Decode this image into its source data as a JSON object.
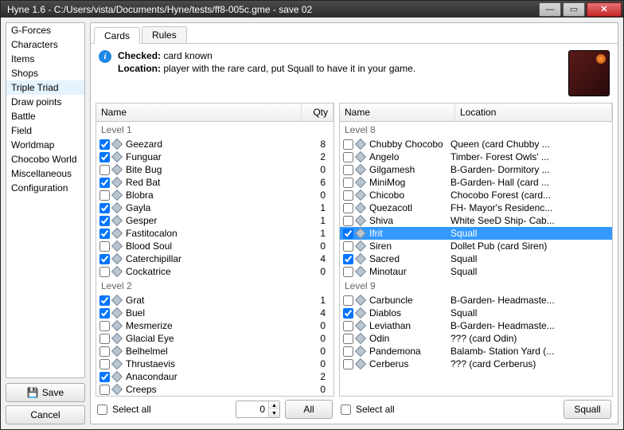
{
  "window": {
    "title": "Hyne 1.6 - C:/Users/vista/Documents/Hyne/tests/ff8-005c.gme - save 02"
  },
  "sidebar": {
    "items": [
      "G-Forces",
      "Characters",
      "Items",
      "Shops",
      "Triple Triad",
      "Draw points",
      "Battle",
      "Field",
      "Worldmap",
      "Chocobo World",
      "Miscellaneous",
      "Configuration"
    ],
    "selected_index": 4,
    "save_label": "Save",
    "cancel_label": "Cancel"
  },
  "tabs": {
    "items": [
      "Cards",
      "Rules"
    ],
    "active_index": 0
  },
  "info": {
    "checked_label": "Checked:",
    "checked_text": "card known",
    "location_label": "Location:",
    "location_text": "player with the rare card, put Squall to have it in your game."
  },
  "left_list": {
    "headers": {
      "name": "Name",
      "qty": "Qty"
    },
    "groups": [
      {
        "label": "Level 1",
        "rows": [
          {
            "checked": true,
            "name": "Geezard",
            "qty": 8
          },
          {
            "checked": true,
            "name": "Funguar",
            "qty": 2
          },
          {
            "checked": false,
            "name": "Bite Bug",
            "qty": 0
          },
          {
            "checked": true,
            "name": "Red Bat",
            "qty": 6
          },
          {
            "checked": false,
            "name": "Blobra",
            "qty": 0
          },
          {
            "checked": true,
            "name": "Gayla",
            "qty": 1
          },
          {
            "checked": true,
            "name": "Gesper",
            "qty": 1
          },
          {
            "checked": true,
            "name": "Fastitocalon",
            "qty": 1
          },
          {
            "checked": false,
            "name": "Blood Soul",
            "qty": 0
          },
          {
            "checked": true,
            "name": "Caterchipillar",
            "qty": 4
          },
          {
            "checked": false,
            "name": "Cockatrice",
            "qty": 0
          }
        ]
      },
      {
        "label": "Level 2",
        "rows": [
          {
            "checked": true,
            "name": "Grat",
            "qty": 1
          },
          {
            "checked": true,
            "name": "Buel",
            "qty": 4
          },
          {
            "checked": false,
            "name": "Mesmerize",
            "qty": 0
          },
          {
            "checked": false,
            "name": "Glacial Eye",
            "qty": 0
          },
          {
            "checked": false,
            "name": "Belhelmel",
            "qty": 0
          },
          {
            "checked": false,
            "name": "Thrustaevis",
            "qty": 0
          },
          {
            "checked": true,
            "name": "Anacondaur",
            "qty": 2
          },
          {
            "checked": false,
            "name": "Creeps",
            "qty": 0
          }
        ]
      }
    ],
    "select_all_label": "Select all",
    "qty_value": "0",
    "all_button": "All"
  },
  "right_list": {
    "headers": {
      "name": "Name",
      "location": "Location"
    },
    "groups": [
      {
        "label": "Level 8",
        "rows": [
          {
            "checked": false,
            "name": "Chubby Chocobo",
            "location": "Queen (card Chubby ..."
          },
          {
            "checked": false,
            "name": "Angelo",
            "location": "Timber- Forest Owls' ..."
          },
          {
            "checked": false,
            "name": "Gilgamesh",
            "location": "B-Garden- Dormitory ..."
          },
          {
            "checked": false,
            "name": "MiniMog",
            "location": "B-Garden- Hall (card ..."
          },
          {
            "checked": false,
            "name": "Chicobo",
            "location": "Chocobo Forest (card..."
          },
          {
            "checked": false,
            "name": "Quezacotl",
            "location": "FH- Mayor's Residenc..."
          },
          {
            "checked": false,
            "name": "Shiva",
            "location": "White SeeD Ship- Cab..."
          },
          {
            "checked": true,
            "name": "Ifrit",
            "location": "Squall",
            "selected": true
          },
          {
            "checked": false,
            "name": "Siren",
            "location": "Dollet Pub (card Siren)"
          },
          {
            "checked": true,
            "name": "Sacred",
            "location": "Squall"
          },
          {
            "checked": false,
            "name": "Minotaur",
            "location": "Squall"
          }
        ]
      },
      {
        "label": "Level 9",
        "rows": [
          {
            "checked": false,
            "name": "Carbuncle",
            "location": "B-Garden- Headmaste..."
          },
          {
            "checked": true,
            "name": "Diablos",
            "location": "Squall"
          },
          {
            "checked": false,
            "name": "Leviathan",
            "location": "B-Garden- Headmaste..."
          },
          {
            "checked": false,
            "name": "Odin",
            "location": "??? (card Odin)"
          },
          {
            "checked": false,
            "name": "Pandemona",
            "location": "Balamb- Station Yard (..."
          },
          {
            "checked": false,
            "name": "Cerberus",
            "location": "??? (card Cerberus)"
          }
        ]
      }
    ],
    "select_all_label": "Select all",
    "squall_button": "Squall"
  }
}
